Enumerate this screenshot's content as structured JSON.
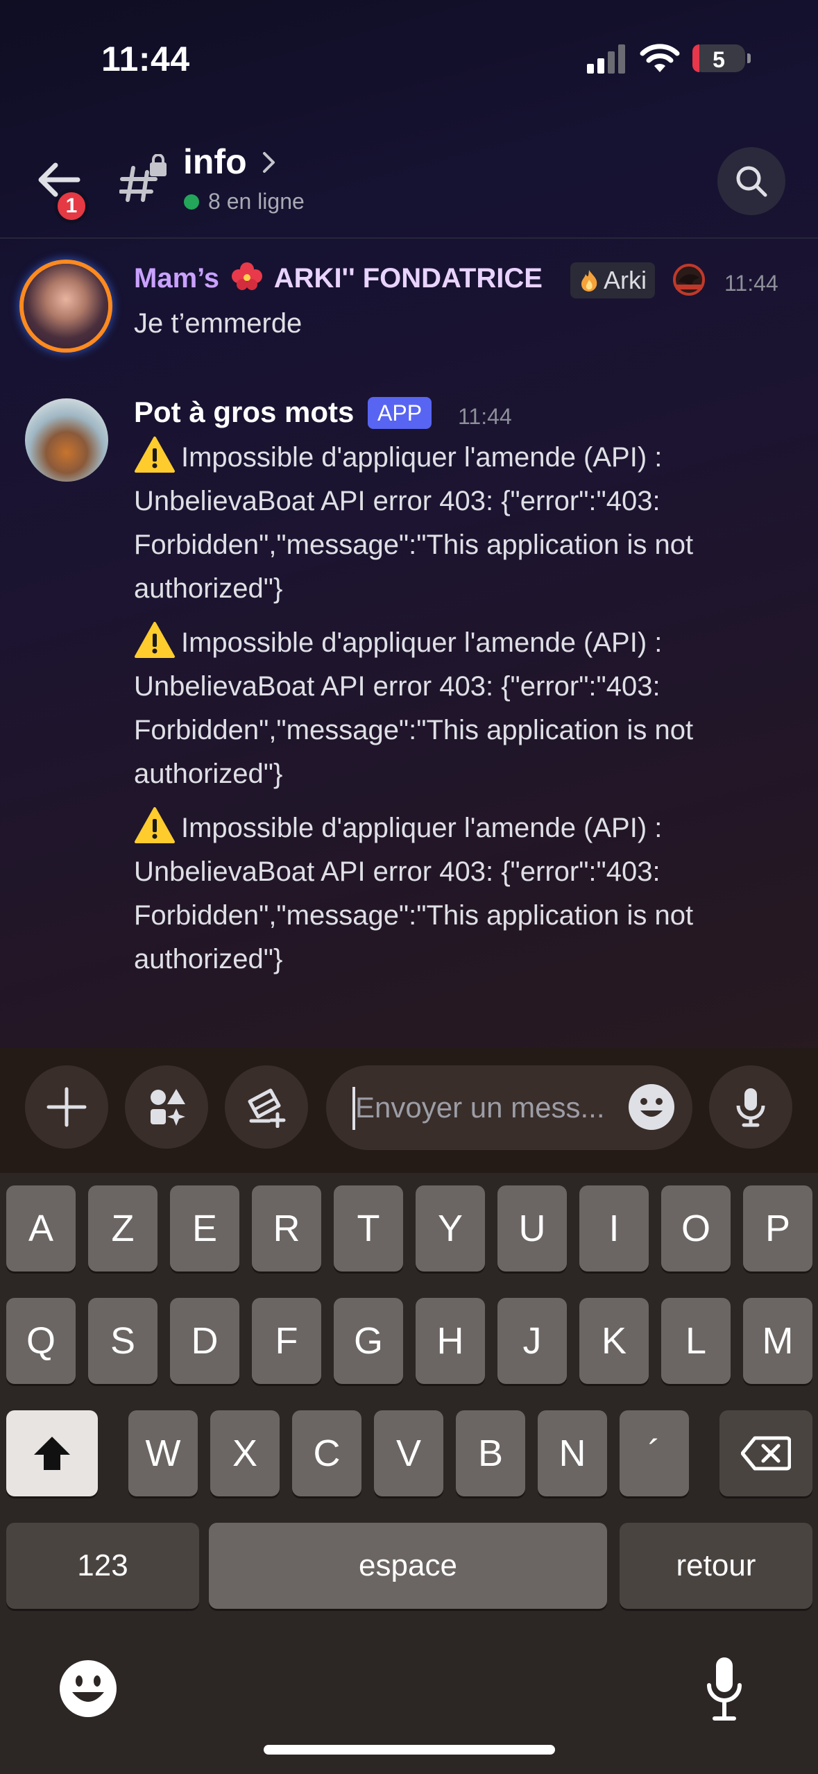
{
  "status_bar": {
    "time": "11:44",
    "battery": "5"
  },
  "header": {
    "back_badge": "1",
    "channel_name": "info",
    "online": "8 en ligne"
  },
  "messages": [
    {
      "author_part1": "Mam’s",
      "author_part2": "ARKI'' FONDATRICE",
      "role_tag": "Arki",
      "timestamp": "11:44",
      "text": "Je t’emmerde"
    },
    {
      "author": "Pot à gros mots",
      "tag": "APP",
      "timestamp": "11:44",
      "lines": [
        "Impossible d'appliquer l'amende (API) : UnbelievaBoat API error 403: {\"error\":\"403: Forbidden\",\"message\":\"This application is not authorized\"}",
        "Impossible d'appliquer l'amende (API) : UnbelievaBoat API error 403: {\"error\":\"403: Forbidden\",\"message\":\"This application is not authorized\"}",
        "Impossible d'appliquer l'amende (API) : UnbelievaBoat API error 403: {\"error\":\"403: Forbidden\",\"message\":\"This application is not authorized\"}"
      ]
    }
  ],
  "composer": {
    "placeholder": "Envoyer un mess..."
  },
  "keyboard": {
    "row1": [
      "A",
      "Z",
      "E",
      "R",
      "T",
      "Y",
      "U",
      "I",
      "O",
      "P"
    ],
    "row2": [
      "Q",
      "S",
      "D",
      "F",
      "G",
      "H",
      "J",
      "K",
      "L",
      "M"
    ],
    "row3": [
      "W",
      "X",
      "C",
      "V",
      "B",
      "N",
      "´"
    ],
    "numbers": "123",
    "space": "espace",
    "return": "retour"
  },
  "colors": {
    "accent": "#5865f2",
    "online": "#23a55a",
    "badge": "#e53944"
  }
}
